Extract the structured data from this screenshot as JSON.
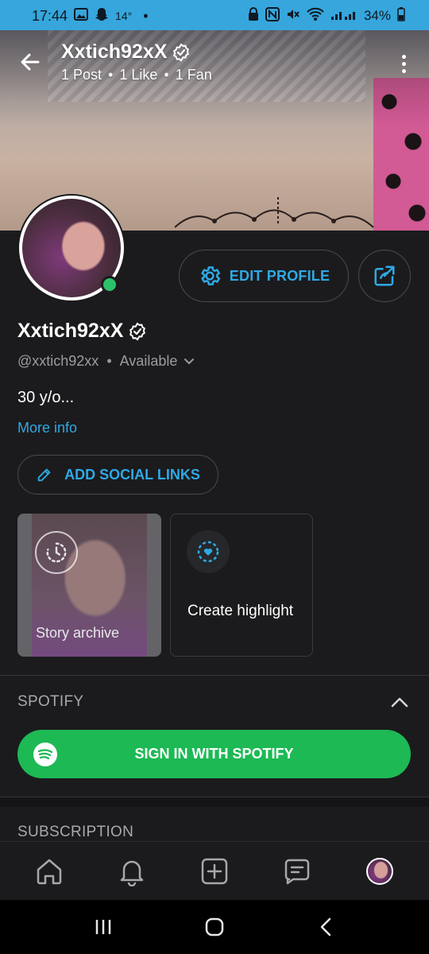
{
  "status_bar": {
    "time": "17:44",
    "temperature": "14°",
    "battery": "34%",
    "icons": [
      "gallery-icon",
      "snapchat-icon",
      "dot-icon",
      "vpn-icon",
      "nfc-icon",
      "mute-icon",
      "wifi-icon",
      "signal-icon",
      "battery-icon"
    ]
  },
  "header": {
    "name": "Xxtich92xX",
    "stats": {
      "posts": "1 Post",
      "likes": "1 Like",
      "fans": "1 Fan",
      "separator": "•"
    }
  },
  "profile": {
    "name": "Xxtich92xX",
    "handle": "@xxtich92xx",
    "separator": "•",
    "availability": "Available",
    "bio": "30 y/o...",
    "more_info": "More info",
    "online": true
  },
  "actions": {
    "edit_profile": "EDIT PROFILE",
    "add_social_links": "ADD SOCIAL LINKS"
  },
  "highlights": {
    "story_archive": "Story archive",
    "create_highlight": "Create highlight"
  },
  "spotify": {
    "title": "SPOTIFY",
    "sign_in": "SIGN IN WITH SPOTIFY"
  },
  "subscription": {
    "title": "SUBSCRIPTION"
  },
  "bottom_nav": [
    "home-icon",
    "bell-icon",
    "add-post-icon",
    "messages-icon",
    "profile-avatar"
  ],
  "colors": {
    "accent": "#2fa9e5",
    "spotify": "#1db954",
    "online": "#2dc06b",
    "background": "#1b1b1d",
    "status_bar": "#36a6dd"
  }
}
